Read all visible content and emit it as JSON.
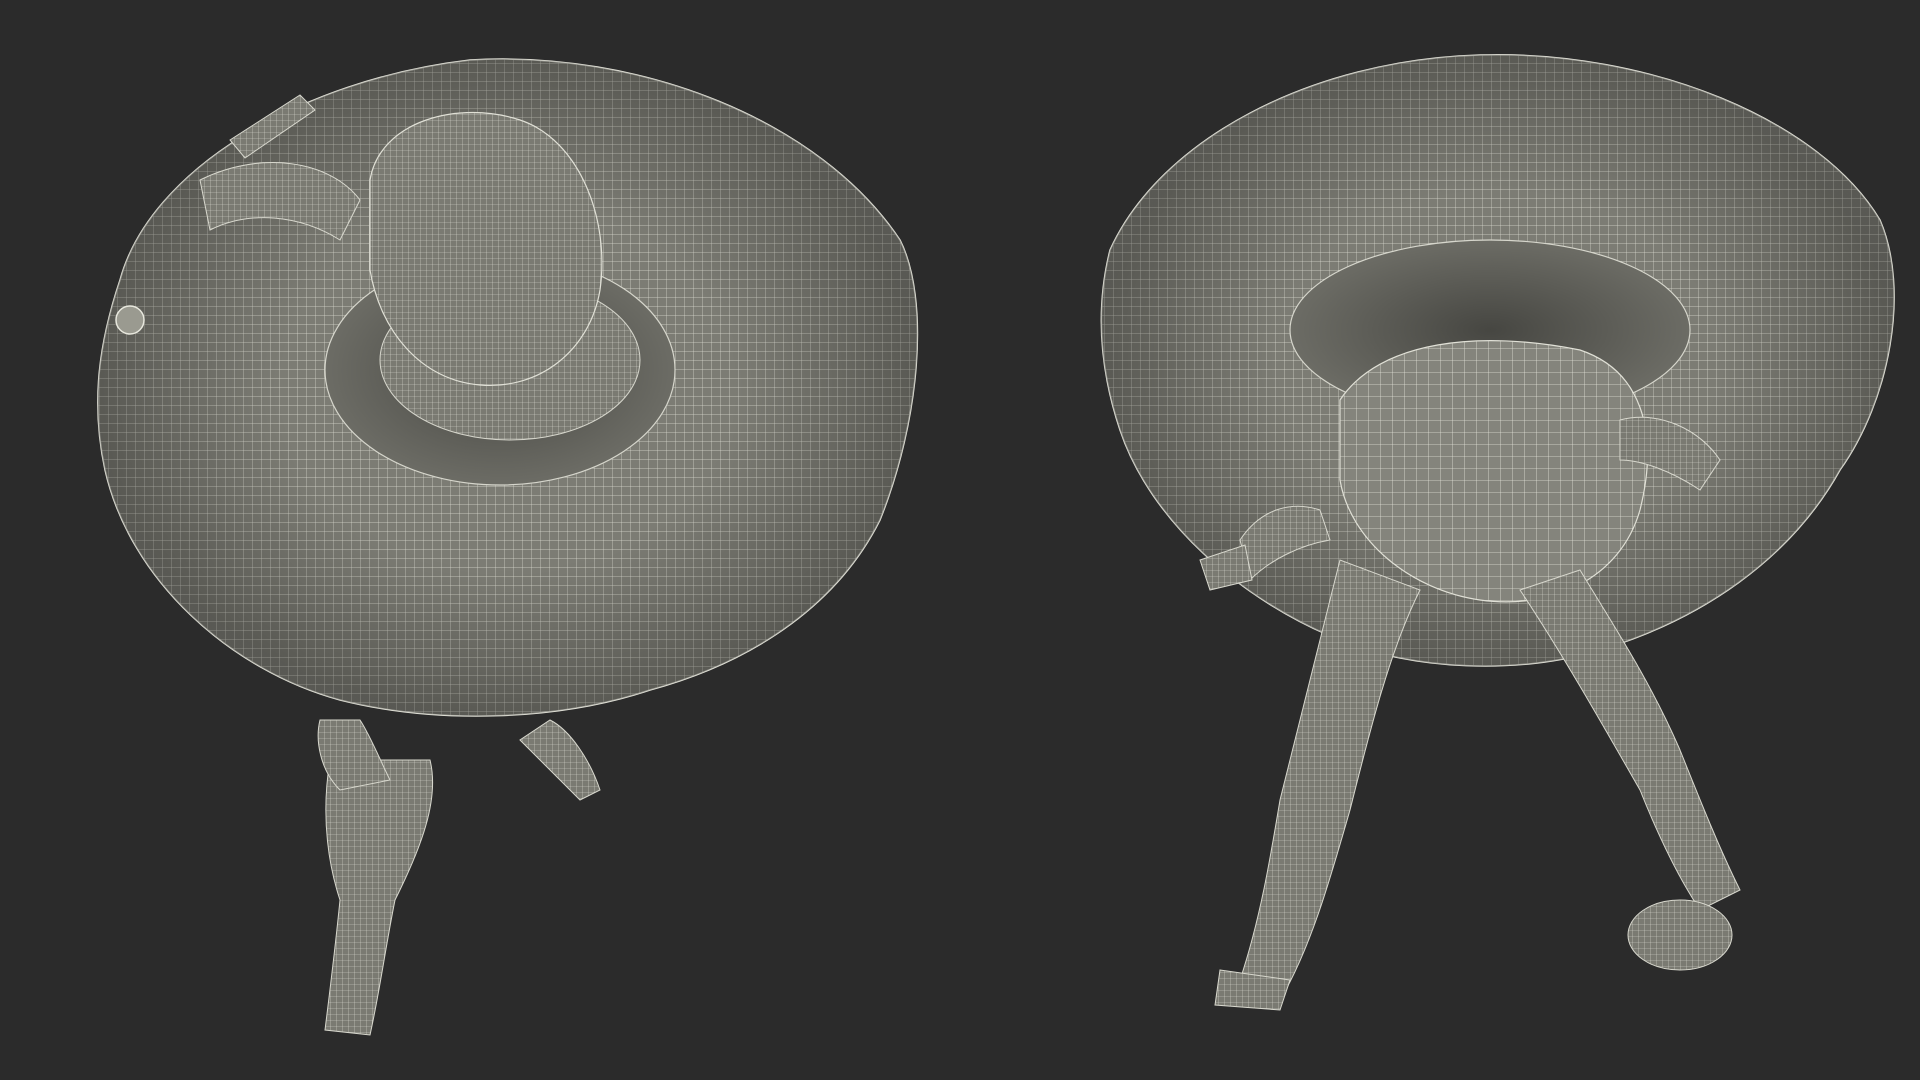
{
  "scene": {
    "background_color": "#2b2b2b",
    "mesh_fill_color": "#7e7e76",
    "mesh_wire_color": "#e8e8de",
    "mesh_shadow_color": "#5f5f58"
  },
  "views": [
    {
      "id": "left",
      "subject": "child-with-swim-ring-top-view"
    },
    {
      "id": "right",
      "subject": "child-with-swim-ring-bottom-view"
    }
  ]
}
